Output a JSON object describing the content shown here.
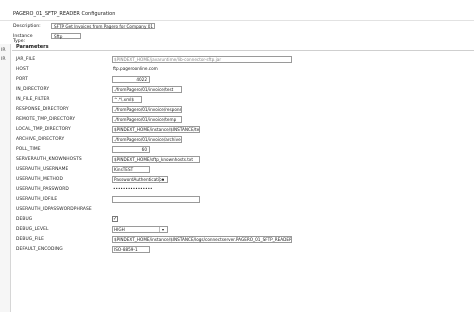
{
  "window": {
    "title": "PAGERO_01_SFTP_READER Configuration"
  },
  "header": {
    "description_label": "Description:",
    "description_value": "SFTP Get Invoices from Pagero for Company 01",
    "instance_type_label": "Instance Type:",
    "instance_type_value": "Sftp"
  },
  "left_strip": {
    "items": [
      "IR",
      "IR"
    ]
  },
  "parameters": {
    "title": "Parameters",
    "items": [
      {
        "name": "JAR_FILE",
        "value": "$PINDEXT_HOME/javaruntime/lib-connector-sftp.jar"
      },
      {
        "name": "HOST",
        "value": "ftp.pageroonline.com"
      },
      {
        "name": "PORT",
        "value": "4022"
      },
      {
        "name": "IN_DIRECTORY",
        "value": "./fromPagero/01/invoice/test"
      },
      {
        "name": "IN_FILE_FILTER",
        "value": "^.*\\.xml$"
      },
      {
        "name": "RESPONSE_DIRECTORY",
        "value": "./fromPagero/01/invoice/response"
      },
      {
        "name": "REMOTE_TMP_DIRECTORY",
        "value": "./fromPagero/01/invoice/temp"
      },
      {
        "name": "LOCAL_TMP_DIRECTORY",
        "value": "$PINDEXT_HOME/instance/$INSTANCE/temp"
      },
      {
        "name": "ARCHIVE_DIRECTORY",
        "value": "./fromPagero/01/invoice/archive"
      },
      {
        "name": "POLL_TIME",
        "value": "60"
      },
      {
        "name": "SERVERAUTH_KNOWNHOSTS",
        "value": "$PINDEXT_HOME/sftp_knownhosts.txt"
      },
      {
        "name": "USERAUTH_USERNAME",
        "value": "KinsTEST"
      },
      {
        "name": "USERAUTH_METHOD",
        "value": "PasswordAuthentication"
      },
      {
        "name": "USERAUTH_PASSWORD",
        "value": "••••••••••••••••"
      },
      {
        "name": "USERAUTH_IDFILE",
        "value": ""
      },
      {
        "name": "USERAUTH_IDPASSWORDPHRASE",
        "value": ""
      },
      {
        "name": "DEBUG",
        "value": "✓"
      },
      {
        "name": "DEBUG_LEVEL",
        "value": "HIGH"
      },
      {
        "name": "DEBUG_FILE",
        "value": "$PINDEXT_HOME/instance/$INSTANCE/logs/connectserver.PAGERO_01_SFTP_READER.log"
      },
      {
        "name": "DEFAULT_ENCODING",
        "value": "ISO-8859-1"
      }
    ]
  }
}
